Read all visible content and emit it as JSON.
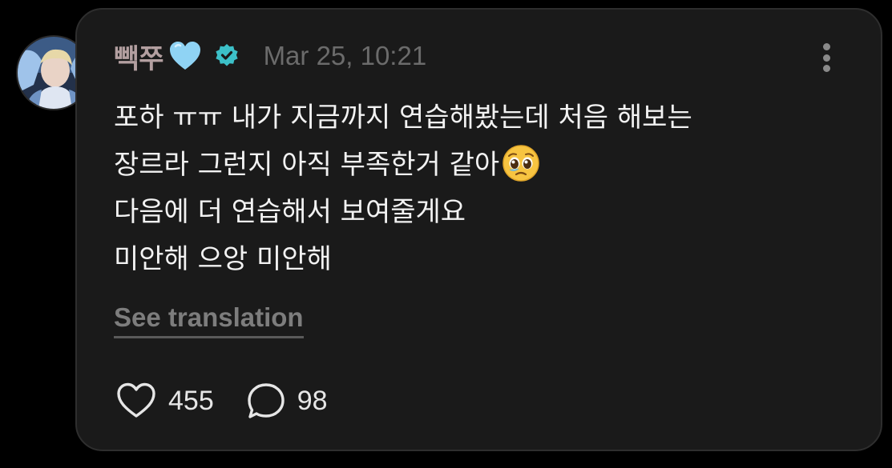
{
  "post": {
    "username": "빽쭈",
    "username_emoji": "light-blue-heart-emoji",
    "verified_icon": "verified-badge-icon",
    "timestamp": "Mar 25, 10:21",
    "lines": [
      "포하 ㅠㅠ 내가 지금까지 연습해봤는데 처음 해보는",
      "장르라 그런지 아직 부족한거 같아",
      "다음에 더 연습해서 보여줄게요",
      "미안해 으앙 미안해"
    ],
    "line_emoji": "pleading-face-emoji",
    "see_translation": "See translation",
    "like_count": "455",
    "comment_count": "98"
  },
  "colors": {
    "background": "#000000",
    "bubble": "#1a1a1a",
    "username": "#b39fa0",
    "verified": "#3cc0c8",
    "heart": "#8fd3f4",
    "muted": "#6b6b6b"
  }
}
